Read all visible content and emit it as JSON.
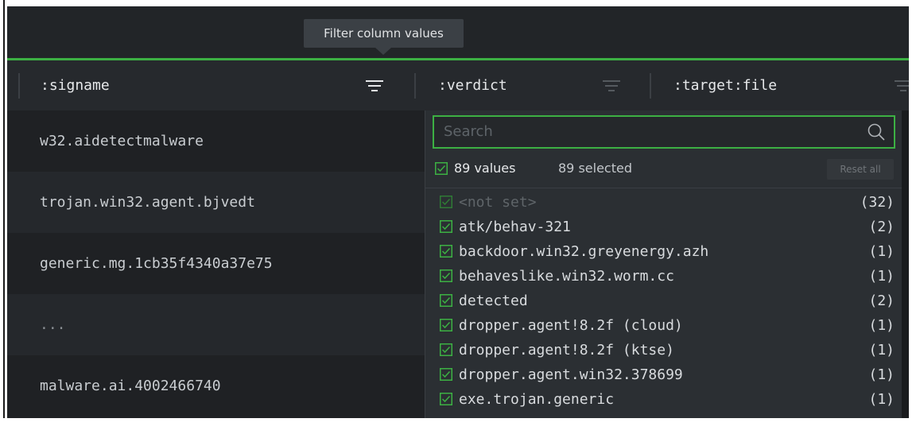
{
  "tooltip": {
    "text": "Filter column values"
  },
  "columns": [
    {
      "name": ":signame"
    },
    {
      "name": ":verdict"
    },
    {
      "name": ":target:file"
    }
  ],
  "rows": [
    {
      "value": "w32.aidetectmalware"
    },
    {
      "value": "trojan.win32.agent.bjvedt"
    },
    {
      "value": "generic.mg.1cb35f4340a37e75"
    },
    {
      "value": "..."
    },
    {
      "value": "malware.ai.4002466740"
    }
  ],
  "filter": {
    "search_placeholder": "Search",
    "summary_count": "89 values",
    "summary_selected": "89 selected",
    "reset_label": "Reset all",
    "items": [
      {
        "label": "<not set>",
        "count": "(32)",
        "checked": true,
        "muted": true
      },
      {
        "label": "atk/behav-321",
        "count": "(2)",
        "checked": true
      },
      {
        "label": "backdoor.win32.greyenergy.azh",
        "count": "(1)",
        "checked": true
      },
      {
        "label": "behaveslike.win32.worm.cc",
        "count": "(1)",
        "checked": true
      },
      {
        "label": "detected",
        "count": "(2)",
        "checked": true
      },
      {
        "label": "dropper.agent!8.2f (cloud)",
        "count": "(1)",
        "checked": true
      },
      {
        "label": "dropper.agent!8.2f (ktse)",
        "count": "(1)",
        "checked": true
      },
      {
        "label": "dropper.agent.win32.378699",
        "count": "(1)",
        "checked": true
      },
      {
        "label": "exe.trojan.generic",
        "count": "(1)",
        "checked": true
      }
    ]
  },
  "colors": {
    "accent": "#3cb043",
    "background": "#1f2124",
    "dropdown": "#2b2f33"
  },
  "icons": {
    "filter": "filter-lines-icon",
    "search": "search-icon",
    "checkbox": "checkbox-checked-icon"
  }
}
